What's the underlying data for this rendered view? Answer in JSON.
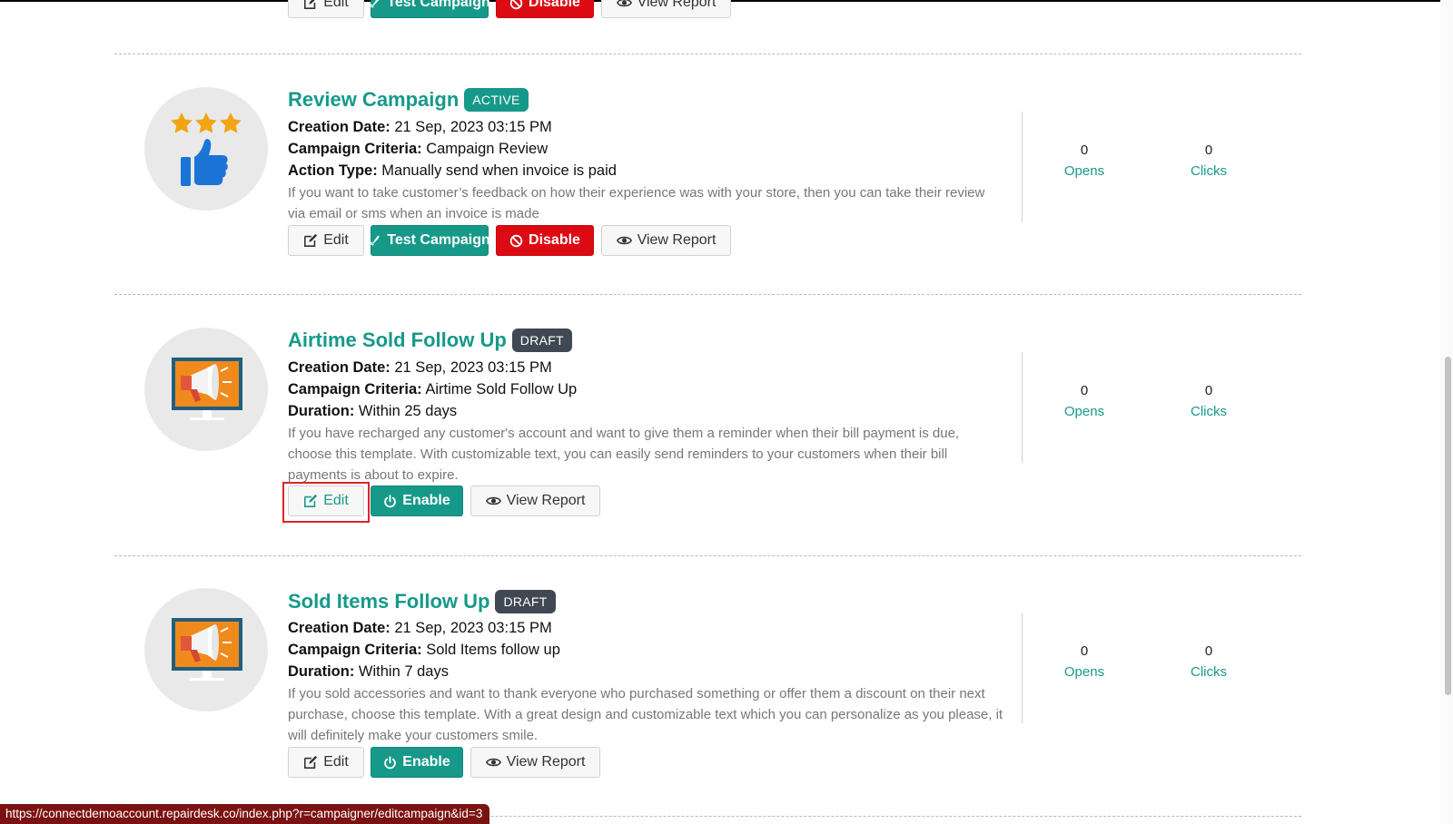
{
  "top_partial": {
    "edit_label": "Edit",
    "test_label": "Test Campaign",
    "disable_label": "Disable",
    "view_report_label": "View Report"
  },
  "campaigns": [
    {
      "title": "Review Campaign",
      "status": "ACTIVE",
      "creation_date_label": "Creation Date:",
      "creation_date": "21 Sep, 2023 03:15 PM",
      "criteria_label": "Campaign Criteria:",
      "criteria": "Campaign Review",
      "extra_label": "Action Type:",
      "extra_value": "Manually send when invoice is paid",
      "description": "If you want to take customer’s feedback on how their experience was with your store, then you can take their review via email or sms when an invoice is made",
      "opens_count": "0",
      "opens_label": "Opens",
      "clicks_count": "0",
      "clicks_label": "Clicks",
      "buttons": {
        "edit": "Edit",
        "test": "Test Campaign",
        "disable": "Disable",
        "view_report": "View Report"
      },
      "icon": "stars-thumbs-up-icon"
    },
    {
      "title": "Airtime Sold Follow Up",
      "status": "DRAFT",
      "creation_date_label": "Creation Date:",
      "creation_date": "21 Sep, 2023 03:15 PM",
      "criteria_label": "Campaign Criteria:",
      "criteria": "Airtime Sold Follow Up",
      "extra_label": "Duration:",
      "extra_value": "Within 25 days",
      "description": "If you have recharged any customer's account and want to give them a reminder when their bill payment is due, choose this template. With customizable text, you can easily send reminders to your customers when their bill payments is about to expire.",
      "opens_count": "0",
      "opens_label": "Opens",
      "clicks_count": "0",
      "clicks_label": "Clicks",
      "buttons": {
        "edit": "Edit",
        "enable": "Enable",
        "view_report": "View Report"
      },
      "icon": "monitor-megaphone-icon"
    },
    {
      "title": "Sold Items Follow Up",
      "status": "DRAFT",
      "creation_date_label": "Creation Date:",
      "creation_date": "21 Sep, 2023 03:15 PM",
      "criteria_label": "Campaign Criteria:",
      "criteria": "Sold Items follow up",
      "extra_label": "Duration:",
      "extra_value": "Within 7 days",
      "description": "If you sold accessories and want to thank everyone who purchased something or offer them a discount on their next purchase, choose this template. With a great design and customizable text which you can personalize as you please, it will definitely make your customers smile.",
      "opens_count": "0",
      "opens_label": "Opens",
      "clicks_count": "0",
      "clicks_label": "Clicks",
      "buttons": {
        "edit": "Edit",
        "enable": "Enable",
        "view_report": "View Report"
      },
      "icon": "monitor-megaphone-icon"
    }
  ],
  "status_bar_url": "https://connectdemoaccount.repairdesk.co/index.php?r=campaigner/editcampaign&id=3",
  "colors": {
    "teal": "#17998a",
    "red": "#dc0a12",
    "draft_badge": "#3f4853",
    "highlight": "#e0232a"
  }
}
